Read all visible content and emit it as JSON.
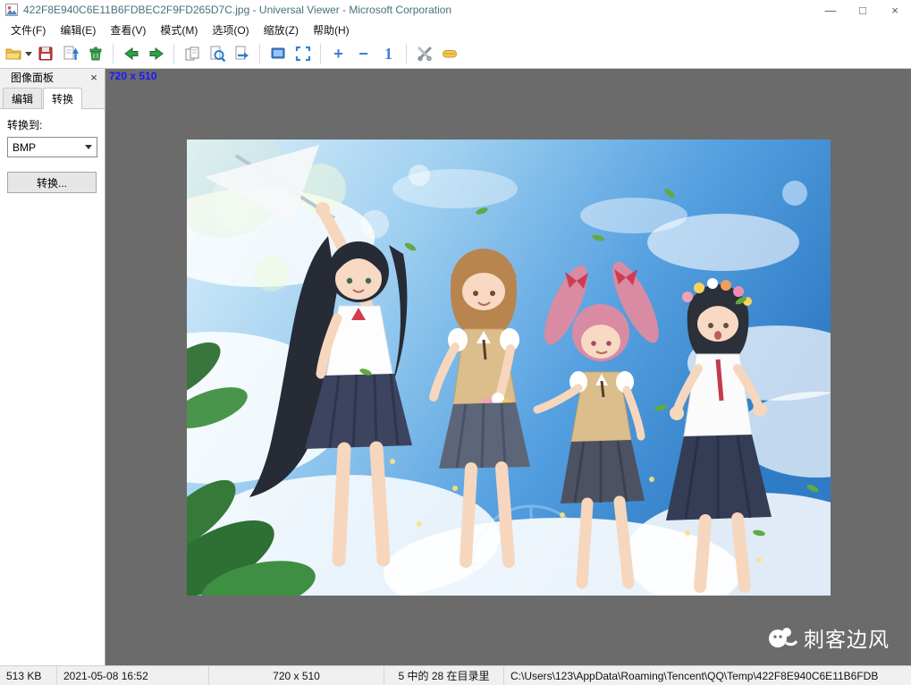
{
  "colors": {
    "viewer_background": "#6b6b6b",
    "dimension_label_blue": "#1818ff",
    "toolbar_blue": "#3b7fd4",
    "arrow_green": "#2f9e44"
  },
  "window": {
    "title": "422F8E940C6E11B6FDBEC2F9FD265D7C.jpg - Universal Viewer - Microsoft Corporation",
    "minimize": "—",
    "maximize": "□",
    "close": "×"
  },
  "menu": {
    "items": [
      {
        "label": "文件(F)"
      },
      {
        "label": "编辑(E)"
      },
      {
        "label": "查看(V)"
      },
      {
        "label": "模式(M)"
      },
      {
        "label": "选项(O)"
      },
      {
        "label": "缩放(Z)"
      },
      {
        "label": "帮助(H)"
      }
    ]
  },
  "toolbar": {
    "icons": [
      "open",
      "save",
      "save-as",
      "delete",
      "previous",
      "next",
      "copy",
      "preview",
      "go-to",
      "fit-window",
      "fullscreen",
      "zoom-in",
      "zoom-out",
      "actual-size",
      "tools",
      "options"
    ],
    "zoom_in_label": "+",
    "zoom_out_label": "−",
    "actual_size_label": "1"
  },
  "sidebar": {
    "title": "图像面板",
    "close": "×",
    "tabs": [
      {
        "label": "编辑",
        "active": false
      },
      {
        "label": "转换",
        "active": true
      }
    ],
    "convert_to_label": "转换到:",
    "format_value": "BMP",
    "convert_button_label": "转换..."
  },
  "viewer": {
    "dimensions_label": "720 x 510",
    "image_description": "anime illustration of four schoolgirls holding hands against a blue sky with clouds"
  },
  "watermark": {
    "text": "刺客边风"
  },
  "statusbar": {
    "file_size": "513 KB",
    "modified": "2021-05-08 16:52",
    "dimensions": "720 x 510",
    "position_in_directory": "5 中的 28 在目录里",
    "file_path": "C:\\Users\\123\\AppData\\Roaming\\Tencent\\QQ\\Temp\\422F8E940C6E11B6FDB"
  }
}
